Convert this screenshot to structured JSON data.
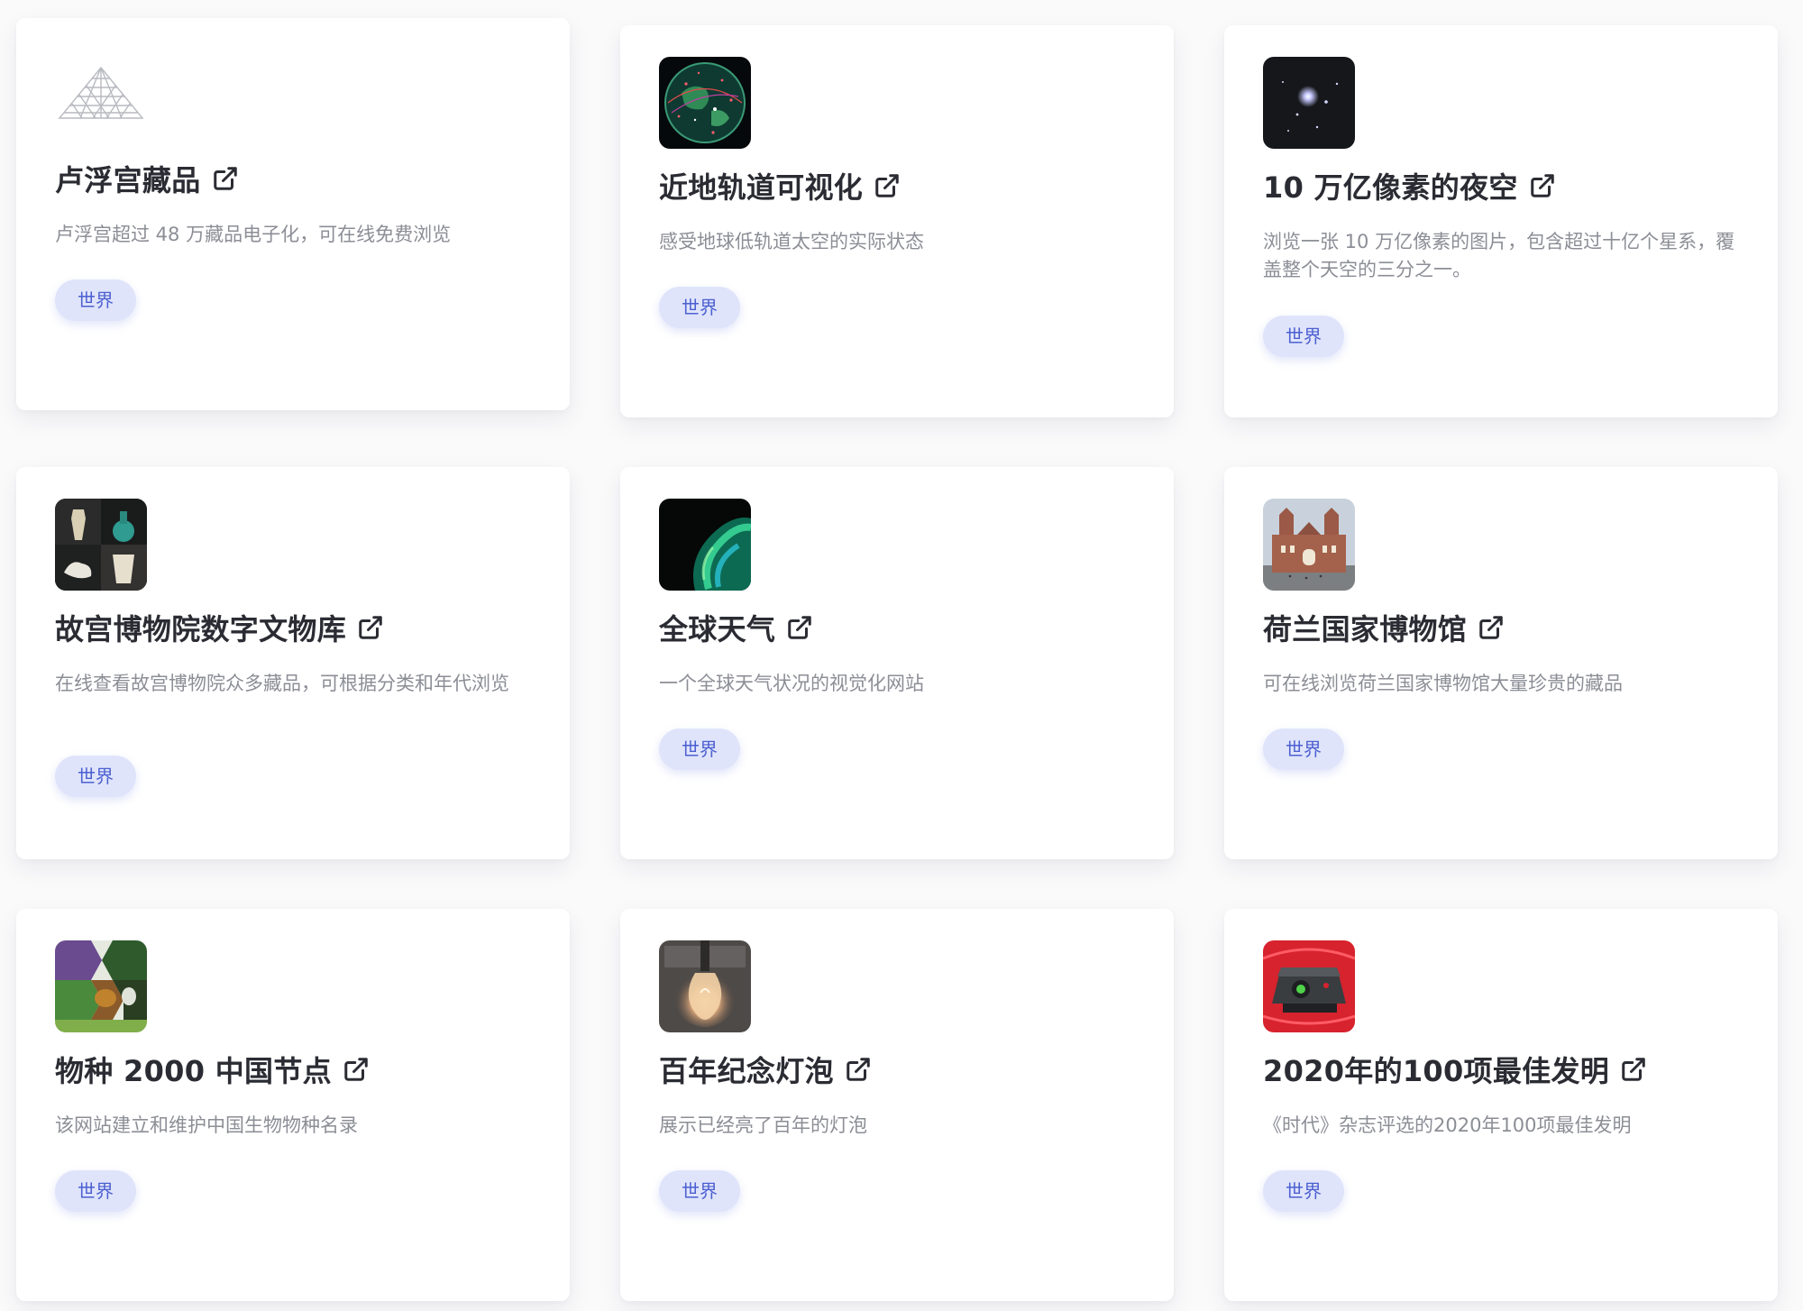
{
  "cards": [
    {
      "title": "卢浮宫藏品",
      "description": "卢浮宫超过 48 万藏品电子化，可在线免费浏览",
      "tag": "世界",
      "icon": "louvre-pyramid-icon"
    },
    {
      "title": "近地轨道可视化",
      "description": "感受地球低轨道太空的实际状态",
      "tag": "世界",
      "icon": "earth-orbit-thumbnail"
    },
    {
      "title": "10 万亿像素的夜空",
      "description": "浏览一张 10 万亿像素的图片，包含超过十亿个星系，覆盖整个天空的三分之一。",
      "tag": "世界",
      "icon": "night-sky-thumbnail"
    },
    {
      "title": "故宫博物院数字文物库",
      "description": "在线查看故宫博物院众多藏品，可根据分类和年代浏览",
      "tag": "世界",
      "icon": "palace-museum-relics-thumbnail"
    },
    {
      "title": "全球天气",
      "description": "一个全球天气状况的视觉化网站",
      "tag": "世界",
      "icon": "global-weather-thumbnail"
    },
    {
      "title": "荷兰国家博物馆",
      "description": "可在线浏览荷兰国家博物馆大量珍贵的藏品",
      "tag": "世界",
      "icon": "rijksmuseum-thumbnail"
    },
    {
      "title": "物种 2000 中国节点",
      "description": "该网站建立和维护中国生物物种名录",
      "tag": "世界",
      "icon": "species-2000-thumbnail"
    },
    {
      "title": "百年纪念灯泡",
      "description": "展示已经亮了百年的灯泡",
      "tag": "世界",
      "icon": "centennial-bulb-thumbnail"
    },
    {
      "title": "2020年的100项最佳发明",
      "description": "《时代》杂志评选的2020年100项最佳发明",
      "tag": "世界",
      "icon": "best-inventions-thumbnail"
    }
  ],
  "colors": {
    "page_background": "#fafafb",
    "card_background": "#ffffff",
    "title": "#2b2c33",
    "description": "#8c8e96",
    "tag_background": "#dfe4fb",
    "tag_text": "#4c5fd0"
  }
}
